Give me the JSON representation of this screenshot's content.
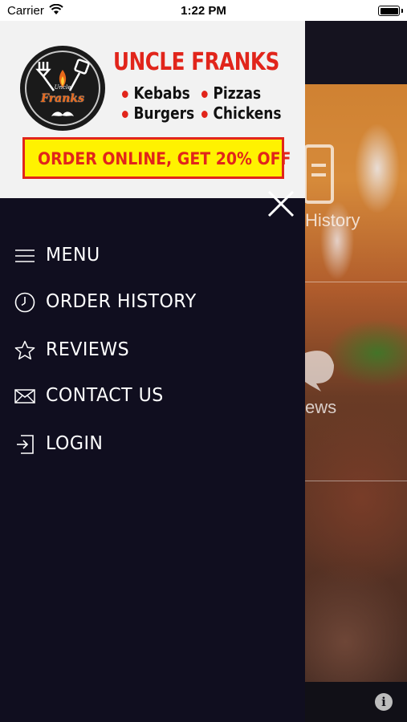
{
  "status_bar": {
    "carrier": "Carrier",
    "time": "1:22 PM",
    "battery_level": 1.0
  },
  "drawer": {
    "header": {
      "logo": {
        "script_small": "Uncle",
        "script_main": "Franks"
      },
      "brand_title": "UNCLE FRANKS",
      "offerings": [
        "Kebabs",
        "Pizzas",
        "Burgers",
        "Chickens"
      ],
      "promo": "ORDER ONLINE, GET 20% OFF"
    },
    "close_icon": "close-icon",
    "nav_items": [
      {
        "label": "MENU",
        "icon": "hamburger-icon"
      },
      {
        "label": "ORDER HISTORY",
        "icon": "clock-icon"
      },
      {
        "label": "REVIEWS",
        "icon": "star-icon"
      },
      {
        "label": "CONTACT US",
        "icon": "envelope-icon"
      },
      {
        "label": "LOGIN",
        "icon": "login-icon"
      }
    ]
  },
  "background": {
    "tile_labels": [
      "History",
      "ews"
    ],
    "info_icon": "info-icon"
  },
  "colors": {
    "drawer_bg": "#100e1f",
    "brand_red": "#e1251b",
    "promo_yellow": "#fff200"
  }
}
